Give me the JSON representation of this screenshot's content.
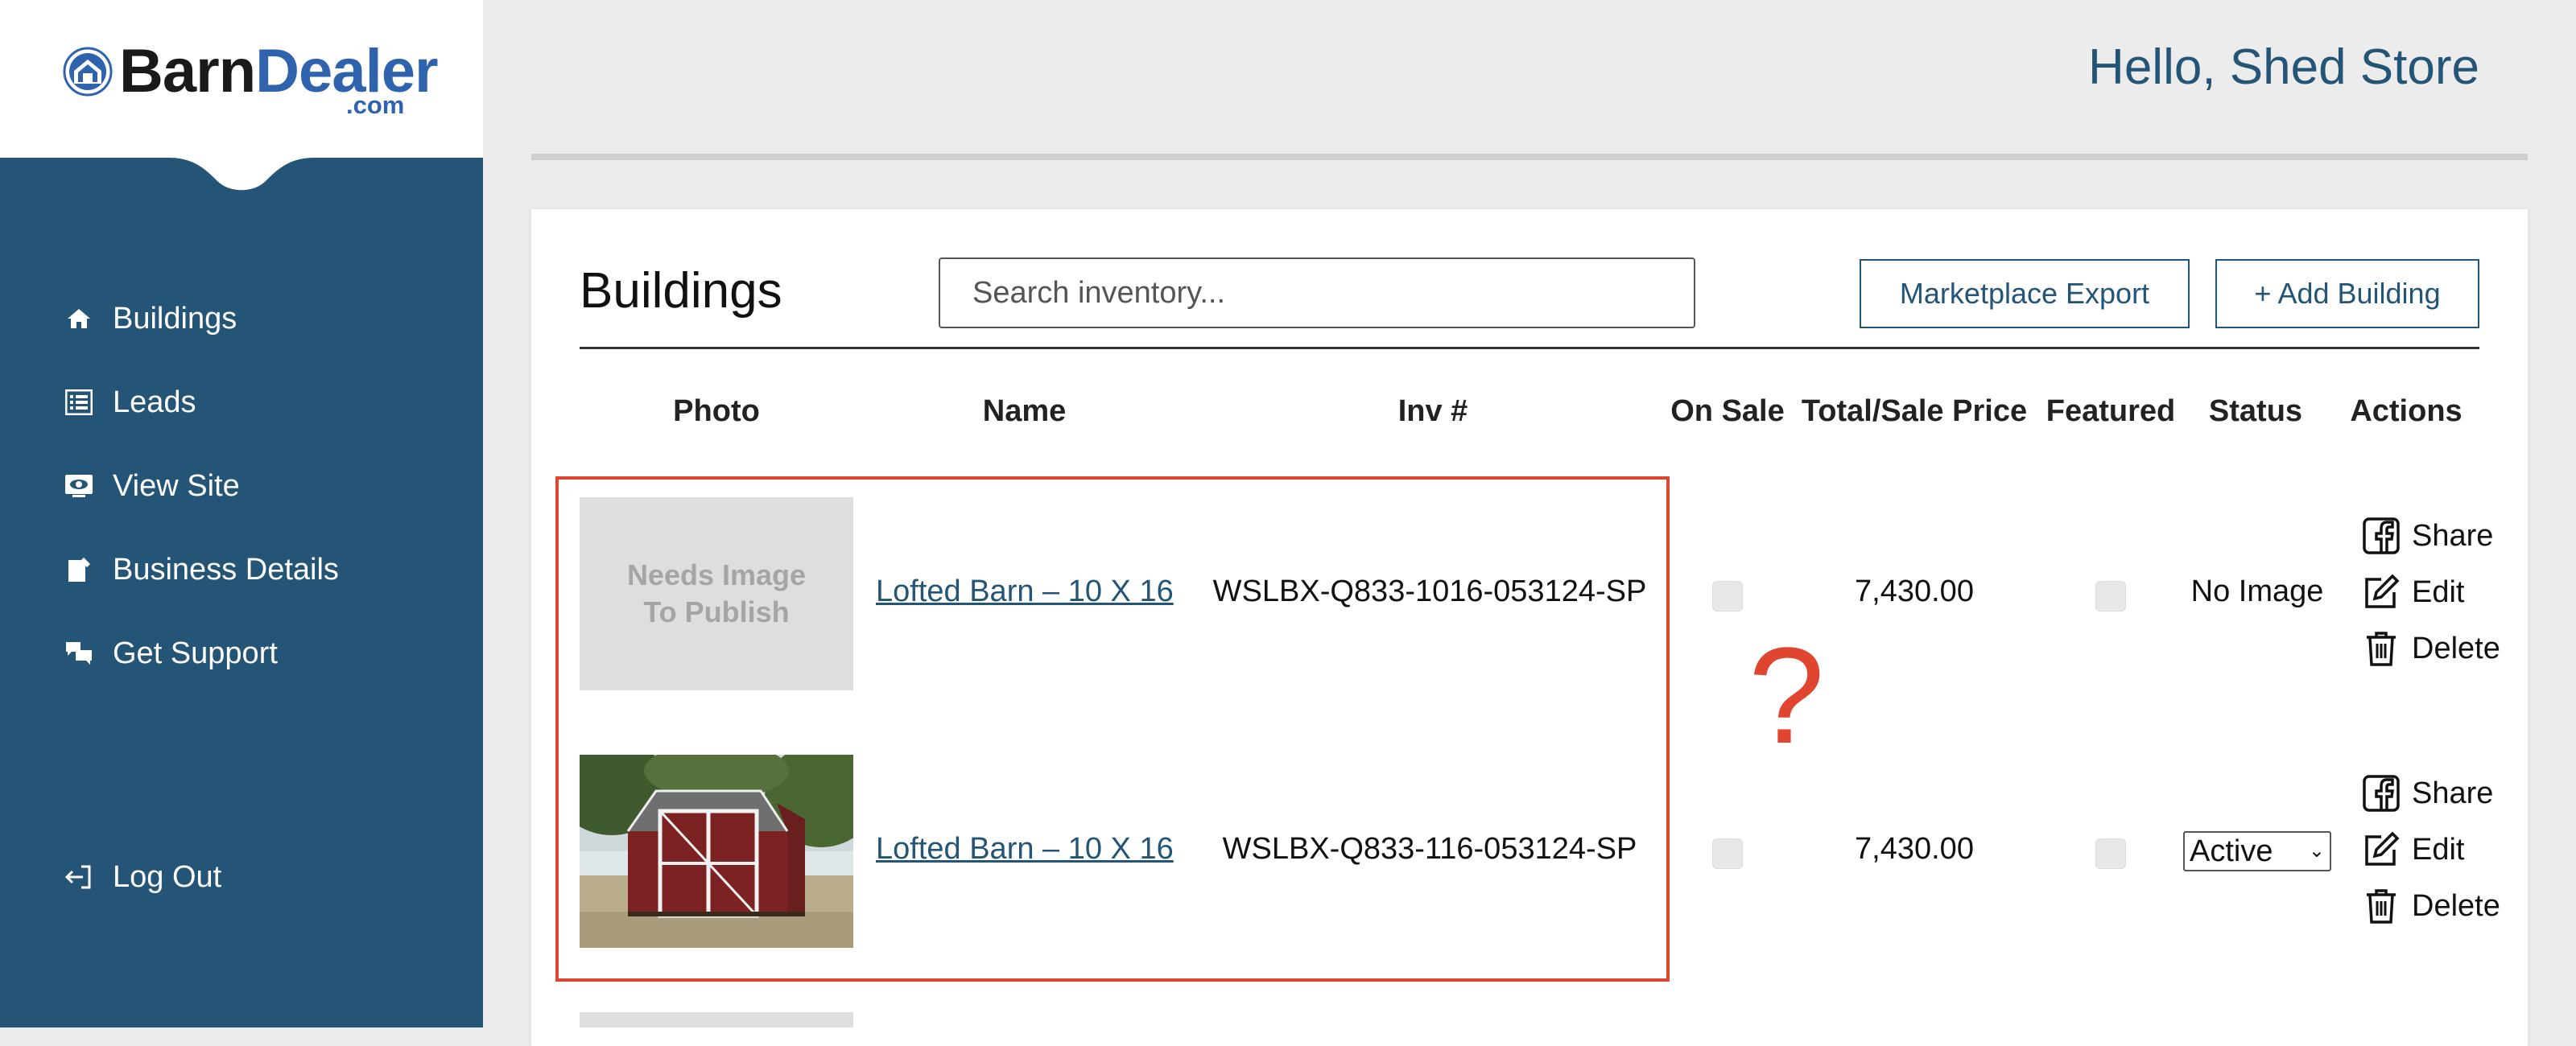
{
  "brand": {
    "name_a": "Barn",
    "name_b": "Dealer",
    "suffix": ".com"
  },
  "sidebar": {
    "items": [
      {
        "label": "Buildings",
        "icon": "home-icon"
      },
      {
        "label": "Leads",
        "icon": "list-icon"
      },
      {
        "label": "View Site",
        "icon": "eye-icon"
      },
      {
        "label": "Business Details",
        "icon": "document-edit-icon"
      },
      {
        "label": "Get Support",
        "icon": "chat-icon"
      }
    ],
    "logout": {
      "label": "Log Out",
      "icon": "logout-icon"
    }
  },
  "header": {
    "greeting": "Hello, Shed Store"
  },
  "main": {
    "title": "Buildings",
    "search": {
      "placeholder": "Search inventory...",
      "value": ""
    },
    "buttons": {
      "export": "Marketplace Export",
      "add": "+ Add Building"
    },
    "columns": [
      "Photo",
      "Name",
      "Inv #",
      "On Sale",
      "Total/Sale Price",
      "Featured",
      "Status",
      "Actions"
    ],
    "rows": [
      {
        "photo_text": "Needs Image To Publish",
        "name": "Lofted Barn – 10 X 16",
        "inv": "WSLBX-Q833-1016-053124-SP",
        "on_sale": false,
        "price": "7,430.00",
        "featured": false,
        "status": "No Image"
      },
      {
        "photo_text": "",
        "name": "Lofted Barn – 10 X 16",
        "inv": "WSLBX-Q833-116-053124-SP",
        "on_sale": false,
        "price": "7,430.00",
        "featured": false,
        "status": "Active"
      }
    ],
    "actions": {
      "share": "Share",
      "edit": "Edit",
      "delete": "Delete"
    },
    "annotation": "?"
  },
  "colors": {
    "sidebar": "#245476",
    "accent": "#2f63ad",
    "highlight": "#e0452f",
    "background": "#ececec"
  }
}
